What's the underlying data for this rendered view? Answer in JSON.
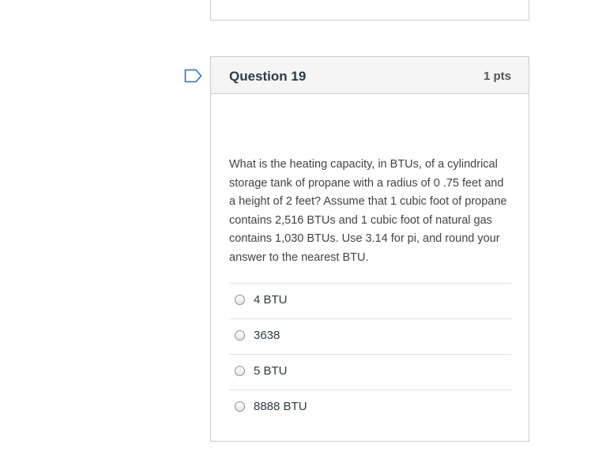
{
  "question": {
    "title": "Question 19",
    "points": "1 pts",
    "text": "What is the heating capacity, in BTUs, of a cylindrical storage tank of propane with a radius of 0 .75 feet and a height of 2 feet? Assume that 1 cubic foot of propane contains 2,516 BTUs and 1 cubic foot of natural gas contains 1,030 BTUs. Use 3.14 for pi, and round your answer to the nearest BTU.",
    "answers": [
      {
        "label": "4 BTU"
      },
      {
        "label": "3638"
      },
      {
        "label": "5 BTU"
      },
      {
        "label": "8888 BTU"
      }
    ]
  },
  "colors": {
    "flag_stroke": "#2d72b8",
    "border": "#c7cdd1",
    "header_bg": "#f5f5f5"
  },
  "icons": {
    "flag": "bookmark-flag-icon",
    "radio": "radio-unchecked-icon"
  }
}
